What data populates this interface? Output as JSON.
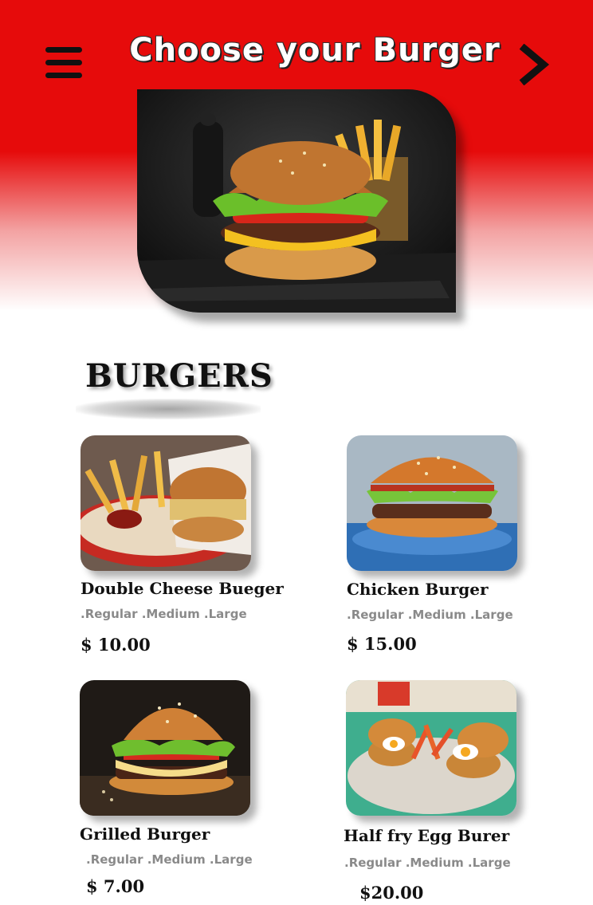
{
  "header": {
    "title": "Choose your Burger",
    "menu_icon": "hamburger-menu-icon",
    "next_icon": "chevron-right-icon",
    "background_color": "#e60b0b"
  },
  "section": {
    "title": "BURGERS"
  },
  "items": [
    {
      "name": "Double Cheese Bueger",
      "sizes": ".Regular .Medium .Large",
      "price": "$ 10.00"
    },
    {
      "name": "Chicken Burger",
      "sizes": ".Regular .Medium .Large",
      "price": "$ 15.00"
    },
    {
      "name": "Grilled Burger",
      "sizes": ".Regular .Medium .Large",
      "price": "$ 7.00"
    },
    {
      "name": "Half fry Egg Burer",
      "sizes": ".Regular .Medium .Large",
      "price": "$20.00"
    }
  ]
}
